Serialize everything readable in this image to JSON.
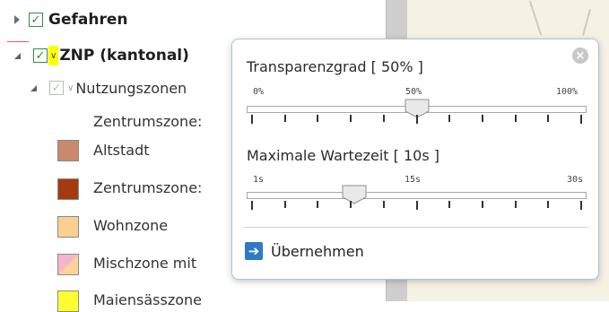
{
  "layer_tree": {
    "gefahren": {
      "label": "Gefahren",
      "checked": "✓"
    },
    "znp": {
      "label": "ZNP (kantonal)",
      "checked": "✓",
      "chevron": "∨"
    },
    "nutzungszonen": {
      "label": "Nutzungszonen",
      "checked": "✓",
      "chevron": "∨"
    },
    "legend_items": [
      {
        "label": "Zentrumszone:",
        "color": ""
      },
      {
        "label": "Altstadt",
        "color": "#c88a6a"
      },
      {
        "label": "Zentrumszone:",
        "color": "#a53a0f"
      },
      {
        "label": "Wohnzone",
        "color": "#fbcf8f"
      },
      {
        "label": "Mischzone mit",
        "color": "#f6b4c8"
      },
      {
        "label": "Maiensässzone",
        "color": "#ffff30"
      }
    ]
  },
  "popup": {
    "close_symbol": "×",
    "transparency": {
      "title": "Transparenzgrad [ 50% ]",
      "min_label": "0%",
      "mid_label": "50%",
      "max_label": "100%",
      "value_fraction": 0.5,
      "tick_count": 11
    },
    "wait_time": {
      "title": "Maximale Wartezeit [ 10s ]",
      "min_label": "1s",
      "mid_label": "15s",
      "max_label": "30s",
      "value_seconds": 10,
      "min_seconds": 1,
      "max_seconds": 30,
      "tick_count": 11
    },
    "apply": {
      "label": "Übernehmen",
      "icon": "arrow-right-icon"
    }
  },
  "colors": {
    "popup_border": "#a9c4e2",
    "checkbox_green": "#2a8a2a",
    "highlight": "#ffff00",
    "apply_icon": "#2e7bc4"
  }
}
